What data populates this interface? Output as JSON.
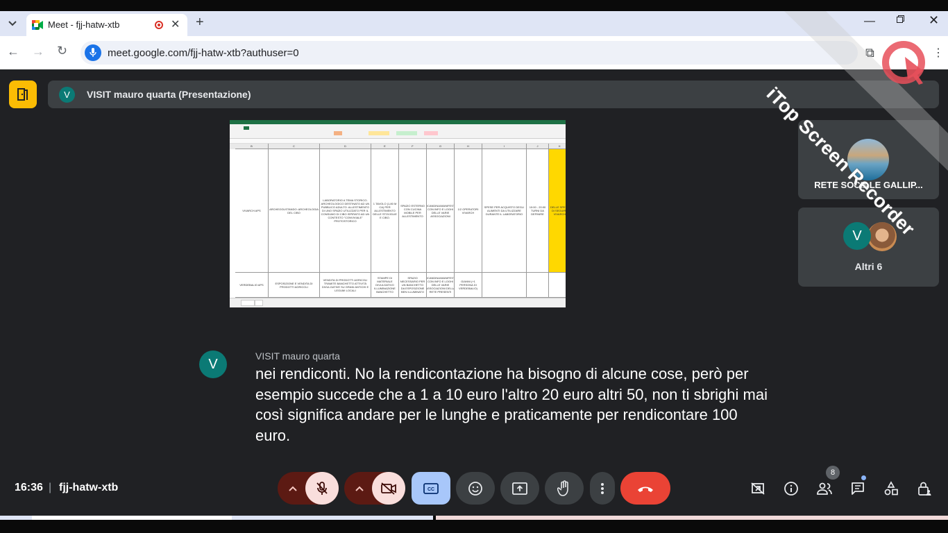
{
  "browser": {
    "tab": {
      "title": "Meet - fjj-hatw-xtb",
      "close_glyph": "✕"
    },
    "new_tab_glyph": "+",
    "address": {
      "url": "meet.google.com/fjj-hatw-xtb?authuser=0"
    }
  },
  "watermark": {
    "text": "iTop Screen Recorder"
  },
  "meet": {
    "presenter_initial": "V",
    "presentation_title": "VISIT mauro quarta (Presentazione)",
    "tiles": [
      {
        "name": "RETE SOCIALE GALLIP..."
      },
      {
        "initial": "V",
        "name": "Altri 6"
      }
    ],
    "caption": {
      "initial": "V",
      "speaker": "VISIT mauro quarta",
      "text": "nei rendiconti. No la rendicontazione ha bisogno di alcune cose, però per esempio succede che a 1 a 10 euro l'altro 20 euro altri 50, non ti sbrighi mai così significa andare per le lunghe e praticamente per rendicontare 100 euro."
    },
    "footer": {
      "time": "16:36",
      "separator": "|",
      "meeting_code": "fjj-hatw-xtb",
      "participants_count": "8"
    },
    "colors": {
      "leave": "#ea4335",
      "captions_on": "#a8c7fa",
      "muted": "#f9dedc",
      "meeting_info": "#fbbc04"
    }
  },
  "sheet": {
    "col_headers": [
      "B",
      "C",
      "D",
      "E",
      "F",
      "G",
      "H",
      "I",
      "J",
      "K"
    ],
    "rows": [
      [
        "VIVARCH APS",
        "ARCHEOGUSTANDO: ARCHEOLOGIA DEL CIBO",
        "LABORATORIO A TEMA STORICO-ARCHEOLOGICO DESTINATO AD UN PUBBLICO ADULTO. ALLESTIMENTO DI UNO SPAZIO UTILIZZATO PER IL CONSUMO DI CIBO ISPIRATO AD UN CONTESTO \"CONVIVIALE\" PROTOSTORICO",
        "1 TAVOLO (1,80 M CA) PER ALLESTIMENTO DELLE STOVIGLIE E CIBO.",
        "SPAZIO ESTERNO CON CUCINA MOBILE PER ALLESTIMENTO",
        "LOCANDINA/MANIFESTO CON INFO E LOGHI DELLE VARIE ASSOCIAZIONI",
        "1/2 OPERATORI VIVARCH",
        "SPESE PER ACQUISTO DEGLI ALIMENTI DA UTILIZZARE DURANTE IL LABORATORIO",
        "10:00 - 20:00 TURNI DA DEFINIRE",
        "DELLE SPESE DI SEGUIRE VIVARCH"
      ],
      [
        "VERDEBALIO APS",
        "ESPOSIZIONE E VENDITA DI PRODOTTI AGRICOLI",
        "VENDITA DI PRODOTTI AGRICOLI TRAMITE BANCHETTO ATTIVITÀ DIVULGATIVE SU GRANI ANTICHI E LEGUMI LOCALI",
        "STAMPE DI MATERIALE DIVULGATIVO ILLUMINAZIONE BANCHETTO",
        "SPAZIO NECESSARIO PER UN BANCHETTO DA ESPOSIZIONE BEN ILLUMINATO",
        "LOCANDINA/MANIFESTO CON INFO E LOGHI DELLE VARIE ASSOCIAZIONI DELLA RETE PRESENTI",
        "GIANNI (+1 PERSONA DI VERDEBALIO)",
        "",
        "",
        ""
      ]
    ]
  }
}
